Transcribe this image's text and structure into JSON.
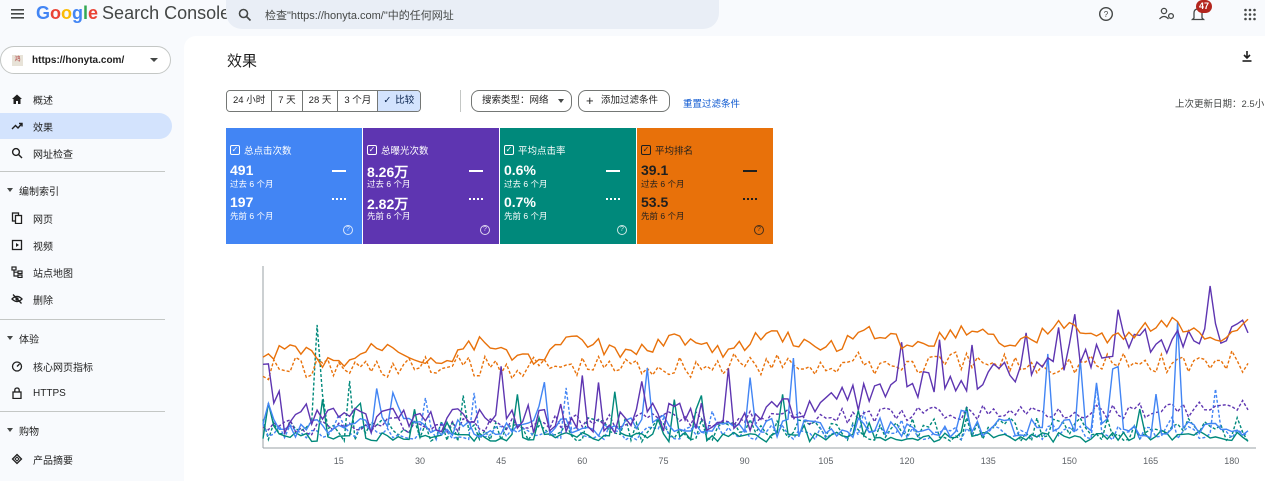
{
  "app": {
    "logo_google": "Google",
    "logo_product": "Search Console",
    "search_placeholder": "检查\"https://honyta.com/\"中的任何网址",
    "notification_count": "47"
  },
  "sidebar": {
    "property_url": "https://honyta.com/",
    "property_favicon_text": "鸿",
    "items_top": [
      {
        "label": "概述",
        "icon": "home-icon"
      },
      {
        "label": "效果",
        "icon": "trending-up-icon",
        "active": true
      },
      {
        "label": "网址检查",
        "icon": "search-icon"
      }
    ],
    "section_index": "编制索引",
    "items_index": [
      {
        "label": "网页",
        "icon": "pages-icon"
      },
      {
        "label": "视频",
        "icon": "video-icon"
      },
      {
        "label": "站点地图",
        "icon": "sitemap-icon"
      },
      {
        "label": "删除",
        "icon": "removals-icon"
      }
    ],
    "section_experience": "体验",
    "items_experience": [
      {
        "label": "核心网页指标",
        "icon": "speed-icon"
      },
      {
        "label": "HTTPS",
        "icon": "lock-icon"
      }
    ],
    "section_shopping": "购物",
    "items_shopping": [
      {
        "label": "产品摘要",
        "icon": "diamond-icon"
      }
    ]
  },
  "main": {
    "title": "效果",
    "export_label": "导出",
    "ranges": [
      "24 小时",
      "7 天",
      "28 天",
      "3 个月",
      "比较"
    ],
    "active_range": "比较",
    "search_type_chip": "搜索类型：网络",
    "add_filter_chip": "添加过滤条件",
    "reset_filters": "重置过滤条件",
    "last_update": "上次更新日期：2.5小"
  },
  "metrics": [
    {
      "title": "总点击次数",
      "value": "491",
      "period": "过去 6 个月",
      "compare_value": "197",
      "compare_period": "先前 6 个月",
      "color": "#4285f4",
      "text_color": "#ffffff"
    },
    {
      "title": "总曝光次数",
      "value": "8.26万",
      "period": "过去 6 个月",
      "compare_value": "2.82万",
      "compare_period": "先前 6 个月",
      "color": "#5e35b1",
      "text_color": "#ffffff"
    },
    {
      "title": "平均点击率",
      "value": "0.6%",
      "period": "过去 6 个月",
      "compare_value": "0.7%",
      "compare_period": "先前 6 个月",
      "color": "#00897b",
      "text_color": "#ffffff"
    },
    {
      "title": "平均排名",
      "value": "39.1",
      "period": "过去 6 个月",
      "compare_value": "53.5",
      "compare_period": "先前 6 个月",
      "color": "#e8710a",
      "text_color": "#1f1f1f"
    }
  ],
  "chart_data": {
    "type": "line",
    "x_tick_labels": [
      "15",
      "30",
      "45",
      "60",
      "75",
      "90",
      "105",
      "120",
      "135",
      "150",
      "165",
      "180"
    ],
    "xlim": [
      1,
      183
    ],
    "grid": false,
    "series_styles": [
      {
        "color": "#4285f4",
        "style": "solid"
      },
      {
        "color": "#5e35b1",
        "style": "solid"
      },
      {
        "color": "#00897b",
        "style": "solid"
      },
      {
        "color": "#e8710a",
        "style": "solid"
      },
      {
        "color": "#4285f4",
        "style": "dashed"
      },
      {
        "color": "#5e35b1",
        "style": "dashed"
      },
      {
        "color": "#00897b",
        "style": "dashed"
      },
      {
        "color": "#e8710a",
        "style": "dashed"
      }
    ]
  }
}
